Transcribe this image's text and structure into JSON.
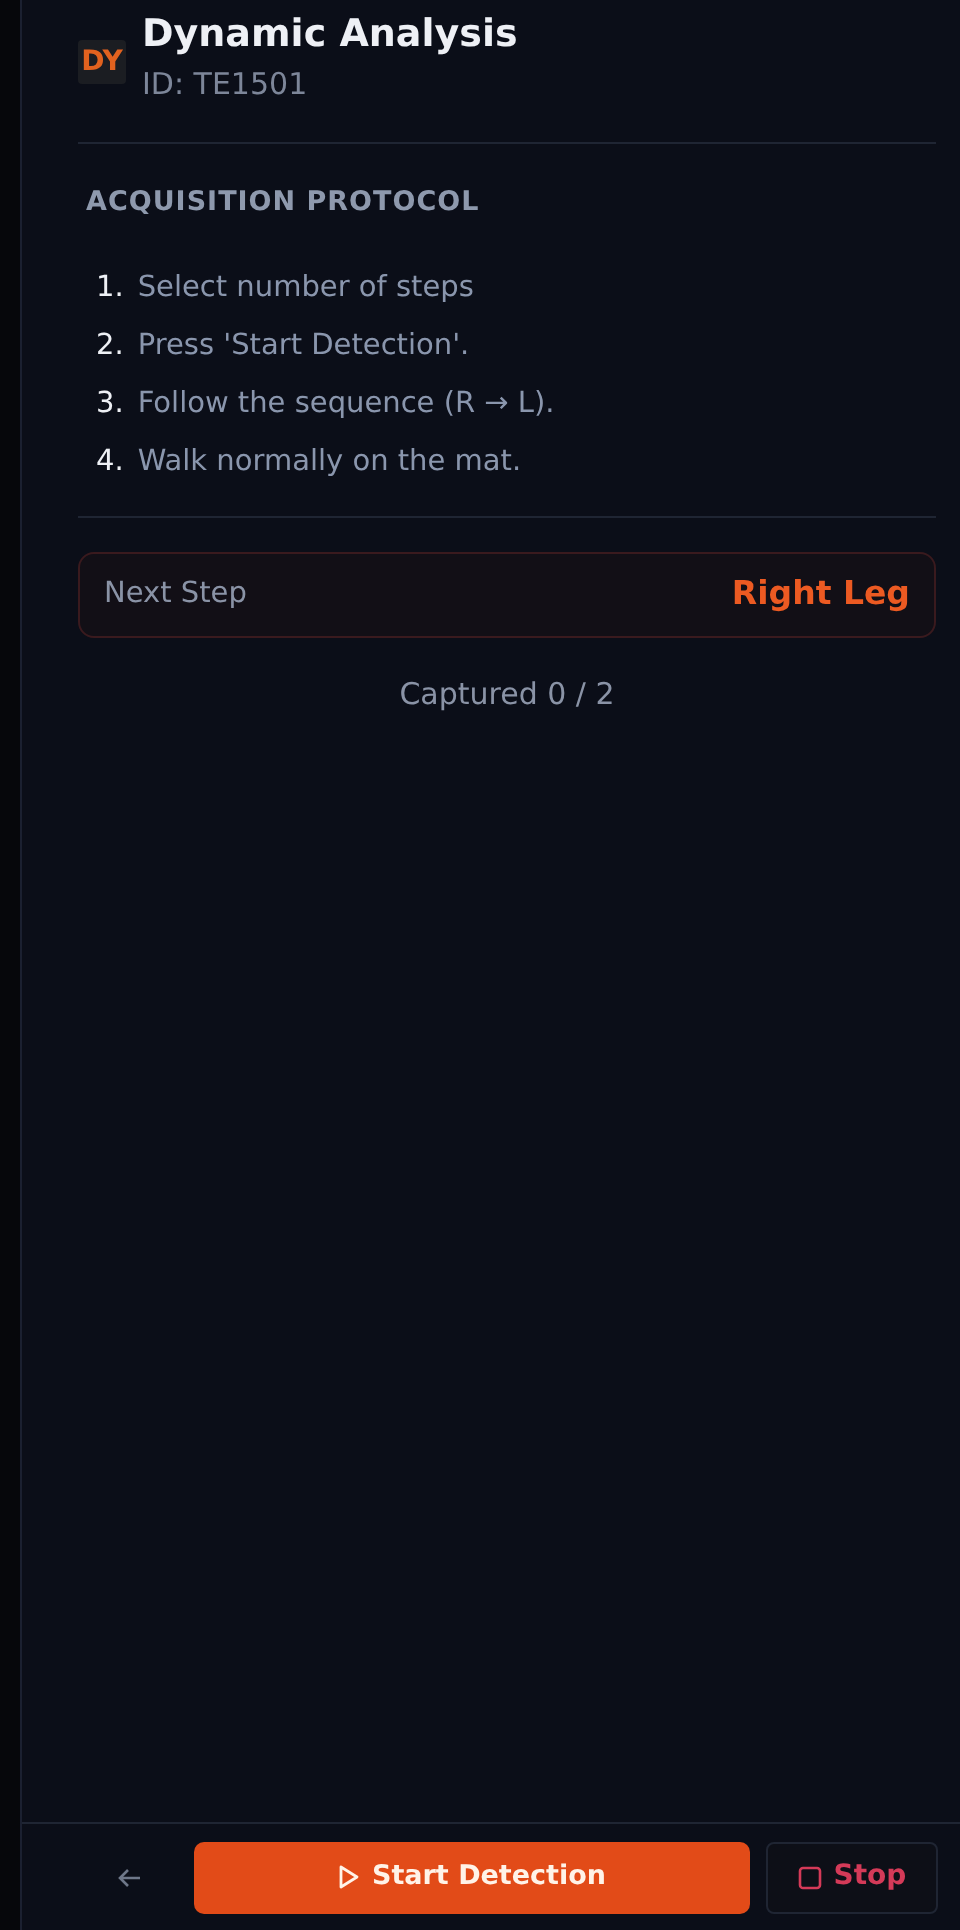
{
  "header": {
    "badge": "DY",
    "title": "Dynamic Analysis",
    "subtitle": "ID: TE1501"
  },
  "protocol": {
    "heading": "ACQUISITION PROTOCOL",
    "steps": [
      {
        "number": "1.",
        "text": "Select number of steps"
      },
      {
        "number": "2.",
        "text": "Press 'Start Detection'."
      },
      {
        "number": "3.",
        "text": "Follow the sequence (R → L)."
      },
      {
        "number": "4.",
        "text": "Walk normally on the mat."
      }
    ]
  },
  "next_step": {
    "label": "Next Step",
    "value": "Right Leg"
  },
  "captured": "Captured 0 / 2",
  "footer": {
    "start_button": "Start Detection",
    "stop_button": "Stop"
  }
}
